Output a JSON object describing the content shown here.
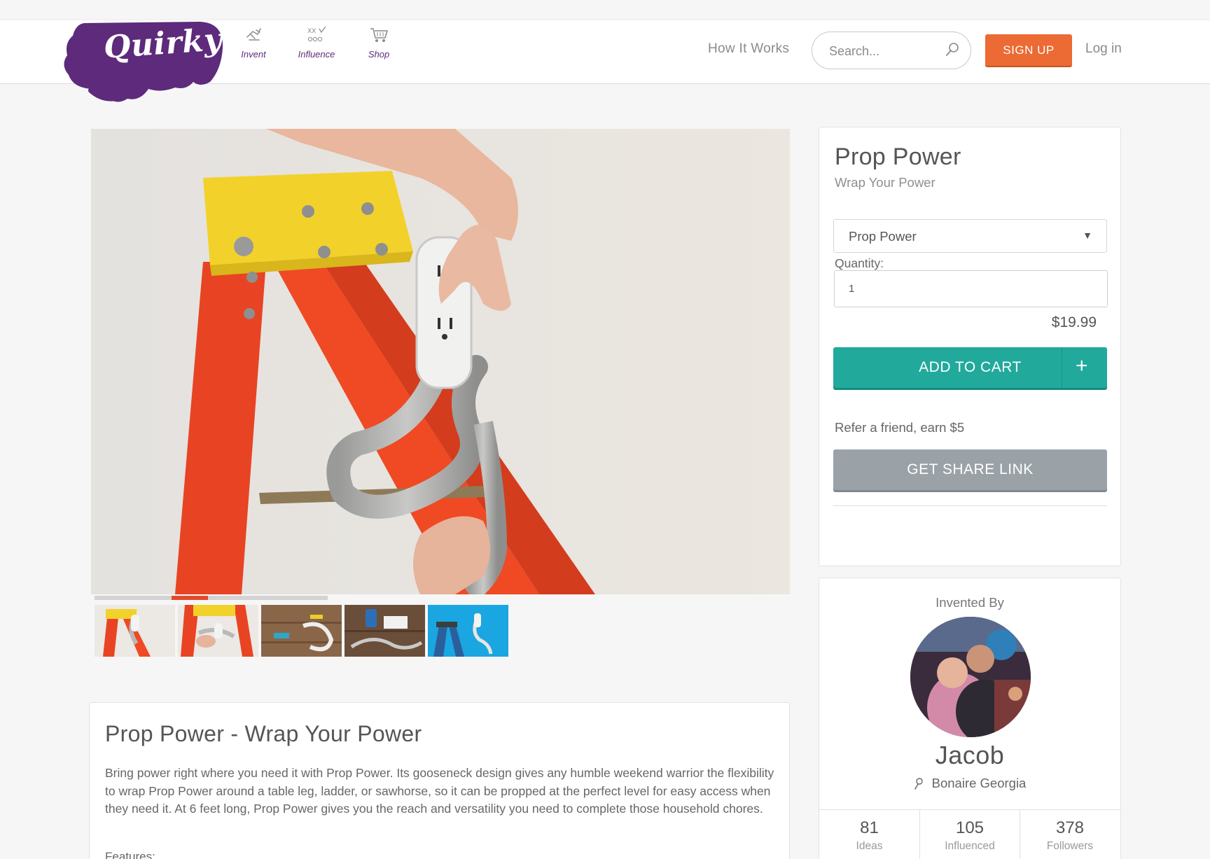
{
  "header": {
    "logo_text": "Quirky",
    "nav": [
      {
        "label": "Invent",
        "icon": "invent-icon"
      },
      {
        "label": "Influence",
        "icon": "influence-icon"
      },
      {
        "label": "Shop",
        "icon": "cart-icon"
      }
    ],
    "how_it_works": "How It Works",
    "search_placeholder": "Search...",
    "signup_label": "SIGN UP",
    "login_label": "Log in",
    "brand_purple": "#5e2a7c",
    "signup_color": "#ec6a33"
  },
  "product": {
    "title": "Prop Power",
    "subtitle": "Wrap Your Power",
    "variant_selected": "Prop Power",
    "quantity_label": "Quantity:",
    "quantity_value": "1",
    "price": "$19.99",
    "add_to_cart_label": "ADD TO CART",
    "refer_text": "Refer a friend, earn $5",
    "share_label": "GET SHARE LINK",
    "accent_teal": "#21a99c",
    "share_gray": "#9aa2a8"
  },
  "gallery": {
    "thumbnail_count": 5
  },
  "description": {
    "title": "Prop Power - Wrap Your Power",
    "body": "Bring power right where you need it with Prop Power. Its gooseneck design gives any humble weekend warrior the flexibility to wrap Prop Power around a table leg, ladder, or sawhorse, so it can be propped at the perfect level for easy access when they need it. At 6 feet long, Prop Power gives you the reach and versatility you need to complete those household chores.",
    "features_label": "Features:"
  },
  "inventor": {
    "heading": "Invented By",
    "name": "Jacob",
    "location": "Bonaire Georgia",
    "stats": [
      {
        "value": "81",
        "label": "Ideas"
      },
      {
        "value": "105",
        "label": "Influenced"
      },
      {
        "value": "378",
        "label": "Followers"
      }
    ]
  }
}
